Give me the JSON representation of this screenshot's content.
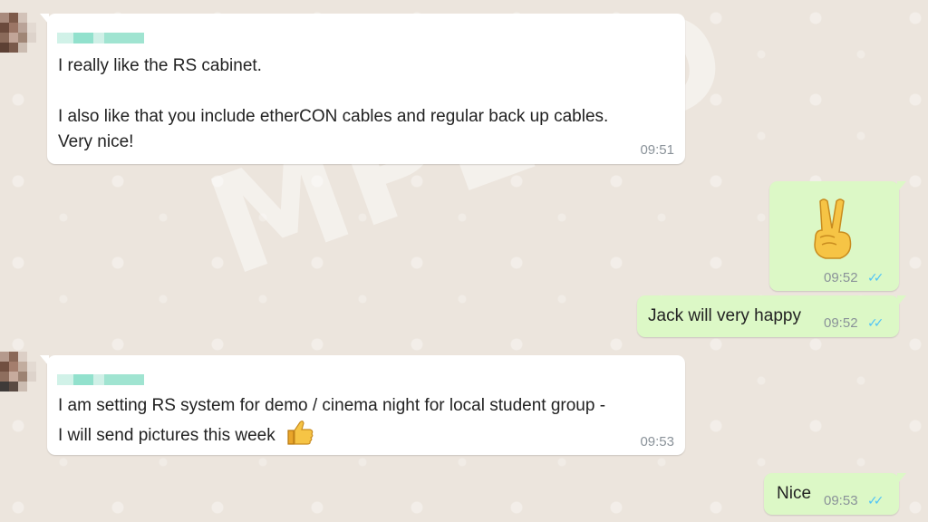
{
  "messages": [
    {
      "direction": "incoming",
      "lines": [
        "I really like the RS cabinet.",
        "",
        "I also like that you include etherCON cables and regular back up cables.",
        "Very nice!"
      ],
      "time": "09:51"
    },
    {
      "direction": "outgoing",
      "emoji": "victory-hand",
      "time": "09:52",
      "status": "read"
    },
    {
      "direction": "outgoing",
      "text": "Jack will very happy",
      "time": "09:52",
      "status": "read"
    },
    {
      "direction": "incoming",
      "lines": [
        "I am setting RS system for demo / cinema night for local student group -",
        "I will send pictures this week"
      ],
      "emoji": "thumbs-up",
      "time": "09:53"
    },
    {
      "direction": "outgoing",
      "text": "Nice",
      "time": "09:53",
      "status": "read"
    }
  ],
  "watermark": "MPLED",
  "colors": {
    "chat_bg": "#ece5dd",
    "incoming_bubble": "#ffffff",
    "outgoing_bubble": "#dcf8c6",
    "read_ticks": "#4fc3f7",
    "timestamp": "#8a9299"
  }
}
